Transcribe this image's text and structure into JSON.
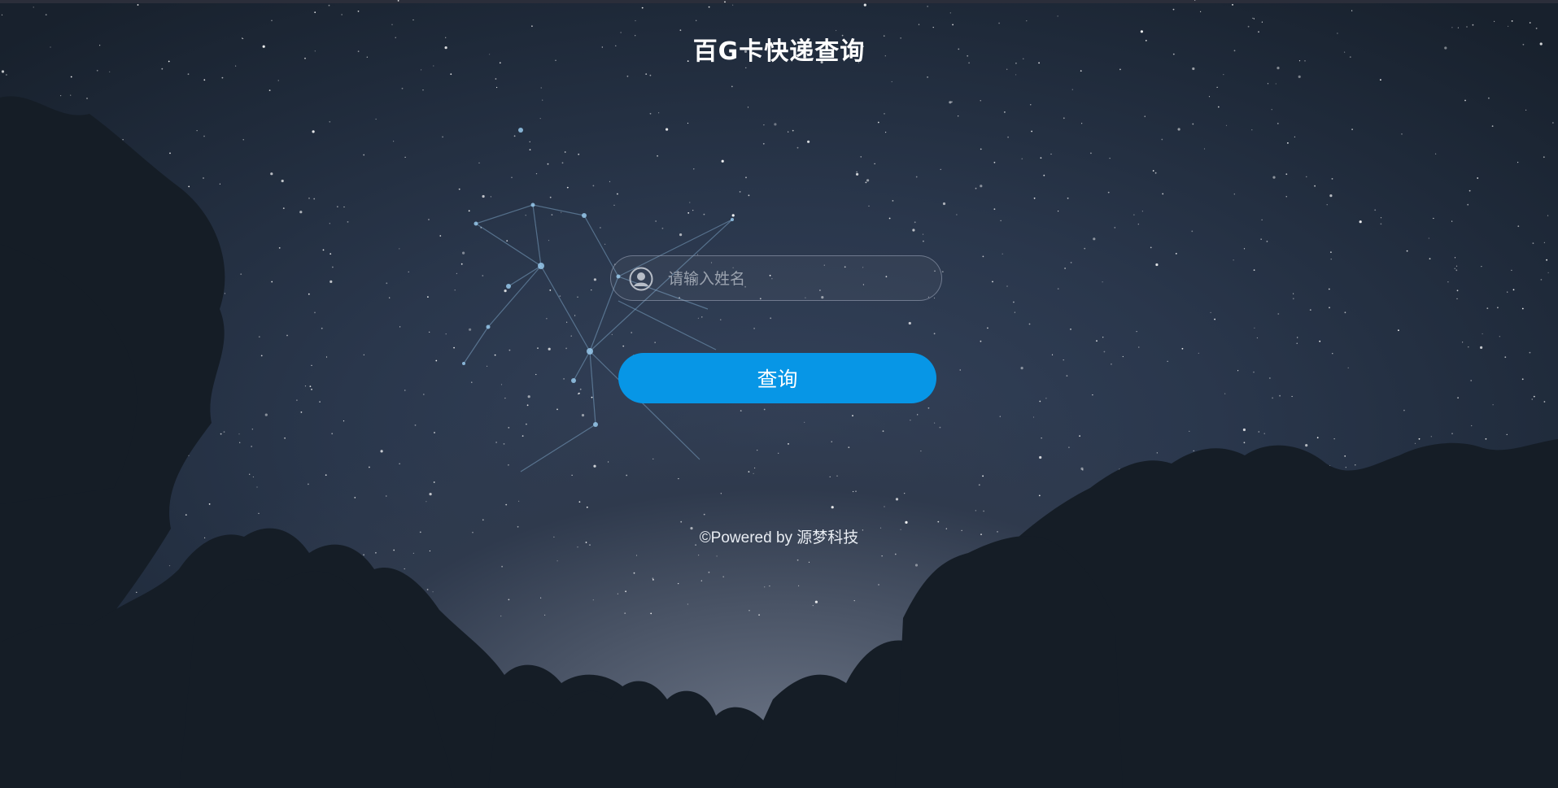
{
  "header": {
    "title": "百G卡快递查询"
  },
  "form": {
    "name_placeholder": "请输入姓名",
    "name_value": "",
    "user_icon": "user-avatar-icon",
    "submit_label": "查询"
  },
  "footer": {
    "text": "©Powered by 源梦科技"
  },
  "colors": {
    "button": "#0796e6",
    "title": "#ffffff",
    "sky_dark": "#18212d",
    "trees": "#161e27"
  }
}
